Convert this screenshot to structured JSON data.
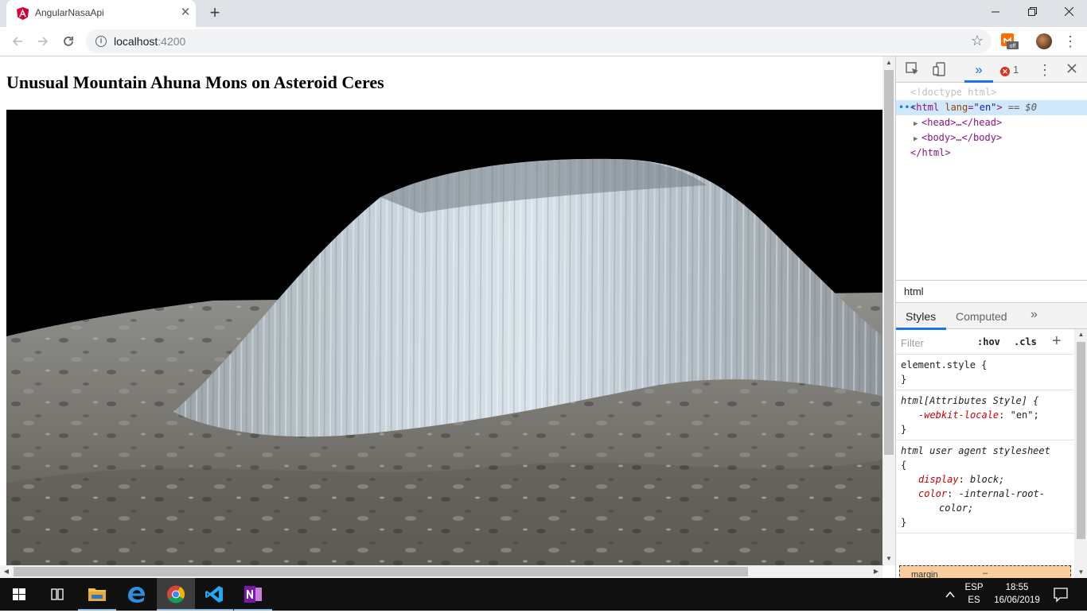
{
  "browser": {
    "tab_title": "AngularNasaApi",
    "tab_favicon": "angular-logo-icon",
    "url_host": "localhost",
    "url_port": ":4200",
    "extension_badge": "off"
  },
  "page": {
    "title": "Unusual Mountain Ahuna Mons on Asteroid Ceres",
    "image_alt_subject": "Ahuna Mons mountain on Ceres"
  },
  "devtools": {
    "error_count": "1",
    "dom": {
      "doctype": "<!doctype html>",
      "html_open_tag": "<html",
      "html_attr_name": "lang",
      "html_attr_value": "\"en\"",
      "html_close_bracket": ">",
      "selected_suffix": " == $0",
      "head": "<head>…</head>",
      "body": "<body>…</body>",
      "html_close": "</html>"
    },
    "breadcrumb": "html",
    "tabs": {
      "styles": "Styles",
      "computed": "Computed",
      "more": "»"
    },
    "filter_placeholder": "Filter",
    "hov": ":hov",
    "cls": ".cls",
    "rules": {
      "element_style_selector": "element.style {",
      "element_style_close": "}",
      "attr_selector": "html[Attributes Style] {",
      "attr_prop": "-webkit-locale",
      "attr_value": "\"en\";",
      "attr_close": "}",
      "ua_selector": "html user agent stylesheet",
      "ua_open": "{",
      "ua_prop1": "display",
      "ua_value1": "block;",
      "ua_prop2": "color",
      "ua_value2": "-internal-root-",
      "ua_value2b": "color;",
      "ua_close": "}"
    },
    "box_model_label": "margin",
    "box_model_value": "–"
  },
  "taskbar": {
    "language_top": "ESP",
    "language_bottom": "ES",
    "time": "18:55",
    "date": "16/06/2019"
  },
  "colors": {
    "accent": "#1a73e8",
    "angular_red": "#dd0031",
    "taskbar_bg": "#101010",
    "error_red": "#d93025"
  }
}
